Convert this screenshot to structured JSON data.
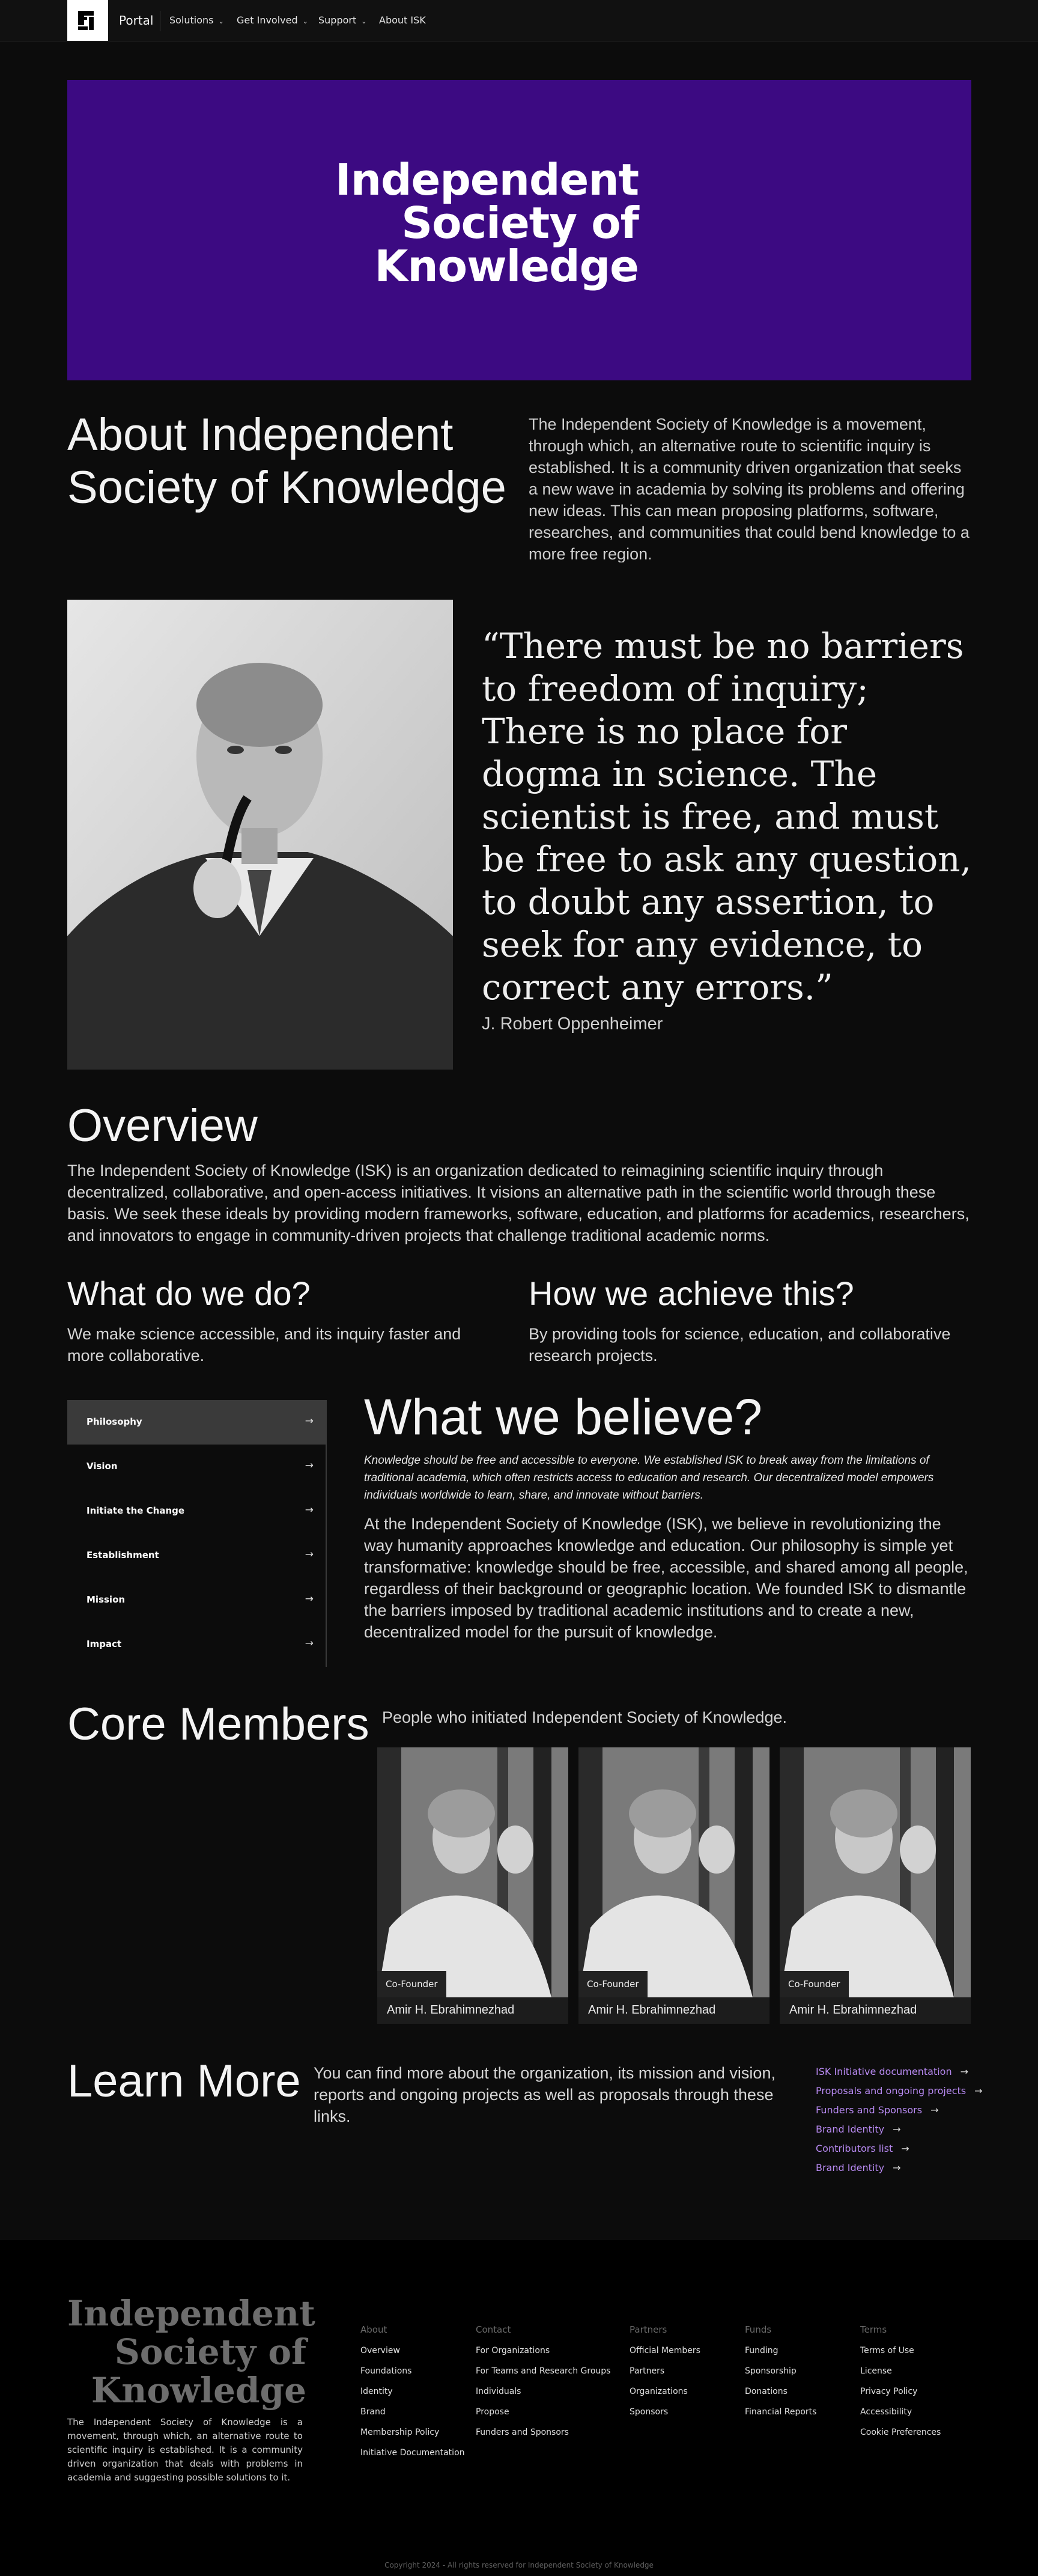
{
  "nav": {
    "portal": "Portal",
    "menu": [
      {
        "label": "Solutions",
        "has_dropdown": true
      },
      {
        "label": "Get Involved",
        "has_dropdown": true
      },
      {
        "label": "Support",
        "has_dropdown": true
      },
      {
        "label": "About ISK",
        "has_dropdown": false
      }
    ]
  },
  "hero": {
    "title_lines": [
      "Independent",
      "Society of",
      "Knowledge"
    ],
    "background": "#3c0a82"
  },
  "about": {
    "heading": "About Independent Society of Knowledge",
    "text": "The Independent Society of Knowledge is a movement, through which, an alternative route to scientific inquiry is established. It is a community driven organization that seeks a new wave in academia by solving its problems and offering new ideas. This can mean proposing platforms, software, researches, and communities that could bend knowledge to a more free region."
  },
  "quote": {
    "text": "“There must be no barriers to freedom of inquiry; There is no place for dogma in science. The scientist is free, and must be free to ask any question, to doubt any assertion, to seek for any evidence, to correct any errors.”",
    "author": "J. Robert Oppenheimer"
  },
  "overview": {
    "heading": "Overview",
    "text": "The Independent Society of Knowledge (ISK) is an organization dedicated to reimagining scientific inquiry through decentralized, collaborative, and open-access initiatives. It visions an alternative path in the scientific world through these basis. We seek these ideals by providing modern frameworks, software, education, and platforms for academics, researchers, and innovators to engage in community-driven projects that challenge traditional academic norms."
  },
  "what": {
    "heading": "What do we do?",
    "text": "We make science accessible, and its inquiry faster and more collaborative."
  },
  "how": {
    "heading": "How we achieve this?",
    "text": "By providing tools for science, education, and collaborative research projects."
  },
  "believe": {
    "tabs": [
      "Philosophy",
      "Vision",
      "Initiate the Change",
      "Establishment",
      "Mission",
      "Impact"
    ],
    "active_tab": "Philosophy",
    "heading": "What we believe?",
    "lead": "Knowledge should be free and accessible to everyone. We established ISK to break away from the limitations of traditional academia, which often restricts access to education and research. Our decentralized model empowers individuals worldwide to learn, share, and innovate without barriers.",
    "text": "At the Independent Society of Knowledge (ISK), we believe in revolutionizing the way humanity approaches knowledge and education. Our philosophy is simple yet transformative: knowledge should be free, accessible, and shared among all people, regardless of their background or geographic location. We founded ISK to dismantle the barriers imposed by traditional academic institutions and to create a new, decentralized model for the pursuit of knowledge."
  },
  "members": {
    "heading": "Core Members",
    "subtitle": "People who initiated Independent Society of Knowledge.",
    "list": [
      {
        "role": "Co-Founder",
        "name": "Amir H. Ebrahimnezhad"
      },
      {
        "role": "Co-Founder",
        "name": "Amir H. Ebrahimnezhad"
      },
      {
        "role": "Co-Founder",
        "name": "Amir H. Ebrahimnezhad"
      }
    ]
  },
  "learn": {
    "heading": "Learn More",
    "text": "You can find more about the organization, its mission and vision, reports and ongoing projects as well as proposals through these links.",
    "links": [
      "ISK Initiative documentation",
      "Proposals and ongoing projects",
      "Funders and Sponsors",
      "Brand Identity",
      "Contributors list",
      "Brand Identity"
    ],
    "link_color": "#b88af2"
  },
  "footer": {
    "title_lines": [
      "Independent",
      "Society of",
      "Knowledge"
    ],
    "description": "The Independent Society of Knowledge is a movement, through which, an alternative route to scientific inquiry is established. It is a community driven organization that deals with problems in academia and suggesting possible solutions to it.",
    "columns": [
      {
        "heading": "About",
        "items": [
          "Overview",
          "Foundations",
          "Identity",
          "Brand",
          "Membership Policy",
          "Initiative Documentation"
        ]
      },
      {
        "heading": "Contact",
        "items": [
          "For Organizations",
          "For Teams and Research Groups",
          "Individuals",
          "Propose",
          "Funders and Sponsors"
        ]
      },
      {
        "heading": "Partners",
        "items": [
          "Official Members",
          "Partners",
          "Organizations",
          "Sponsors"
        ]
      },
      {
        "heading": "Funds",
        "items": [
          "Funding",
          "Sponsorship",
          "Donations",
          "Financial Reports"
        ]
      },
      {
        "heading": "Terms",
        "items": [
          "Terms of Use",
          "License",
          "Privacy Policy",
          "Accessibility",
          "Cookie Preferences"
        ]
      }
    ],
    "copyright": "Copyright 2024 - All rights reserved for Independent Society of Knowledge"
  }
}
